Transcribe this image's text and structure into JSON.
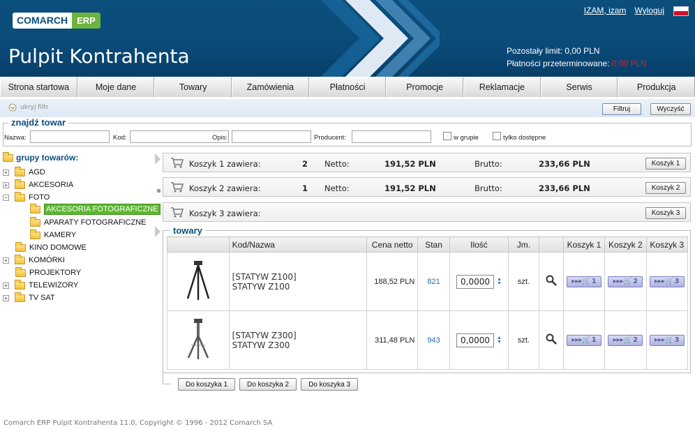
{
  "header": {
    "logo_left": "COMARCH",
    "logo_right": "ERP",
    "title": "Pulpit Kontrahenta",
    "user_link": "IZAM, izam",
    "logout_link": "Wyloguj",
    "limit_label": "Pozostały limit:",
    "limit_value": "0,00 PLN",
    "overdue_label": "Płatności przeterminowane:",
    "overdue_value": "0,00 PLN",
    "overdue_color": "#e21c1c"
  },
  "nav": [
    "Strona startowa",
    "Moje dane",
    "Towary",
    "Zamówienia",
    "Płatności",
    "Promocje",
    "Reklamacje",
    "Serwis",
    "Produkcja"
  ],
  "filter": {
    "hide_label": "ukryj filtr",
    "filter_button": "Filtruj",
    "clear_button": "Wyczyść"
  },
  "search": {
    "legend": "znajdź towar",
    "name_label": "Nazwa:",
    "code_label": "Kod:",
    "desc_label": "Opis:",
    "producer_label": "Producent:",
    "in_group_label": "w grupie",
    "available_label": "tylko dostępne"
  },
  "tree": {
    "title": "grupy towarów:",
    "items": [
      "AGD",
      "AKCESORIA",
      "FOTO",
      "AKCESORIA FOTOGRAFICZNE",
      "APARATY FOTOGRAFICZNE",
      "KAMERY",
      "KINO DOMOWE",
      "KOMÓRKI",
      "PROJEKTORY",
      "TELEWIZORY",
      "TV SAT"
    ]
  },
  "carts": [
    {
      "label": "Koszyk 1 zawiera:",
      "count": "2",
      "netto_label": "Netto:",
      "netto": "191,52 PLN",
      "brutto_label": "Brutto:",
      "brutto": "233,66 PLN",
      "button": "Koszyk 1"
    },
    {
      "label": "Koszyk 2 zawiera:",
      "count": "1",
      "netto_label": "Netto:",
      "netto": "191,52 PLN",
      "brutto_label": "Brutto:",
      "brutto": "233,66 PLN",
      "button": "Koszyk 2"
    },
    {
      "label": "Koszyk 3 zawiera:",
      "count": "",
      "netto_label": "",
      "netto": "",
      "brutto_label": "",
      "brutto": "",
      "button": "Koszyk 3"
    }
  ],
  "products": {
    "legend": "towary",
    "columns": [
      "",
      "Kod/Nazwa",
      "Cena netto",
      "Stan",
      "Ilość",
      "Jm.",
      "",
      "Koszyk 1",
      "Koszyk 2",
      "Koszyk 3"
    ],
    "rows": [
      {
        "code": "[STATYW Z100]",
        "name": "STATYW Z100",
        "price": "188,52 PLN",
        "stock": "821",
        "qty": "0,0000",
        "unit": "szt."
      },
      {
        "code": "[STATYW Z300]",
        "name": "STATYW Z300",
        "price": "311,48 PLN",
        "stock": "943",
        "qty": "0,0000",
        "unit": "szt."
      }
    ],
    "cart_nums": [
      "1",
      "2",
      "3"
    ]
  },
  "bottom_buttons": [
    "Do koszyka 1",
    "Do koszyka 2",
    "Do koszyka 3"
  ],
  "footer": "Comarch ERP Pulpit Kontrahenta 11.0, Copyright © 1996 - 2012 Comarch SA"
}
